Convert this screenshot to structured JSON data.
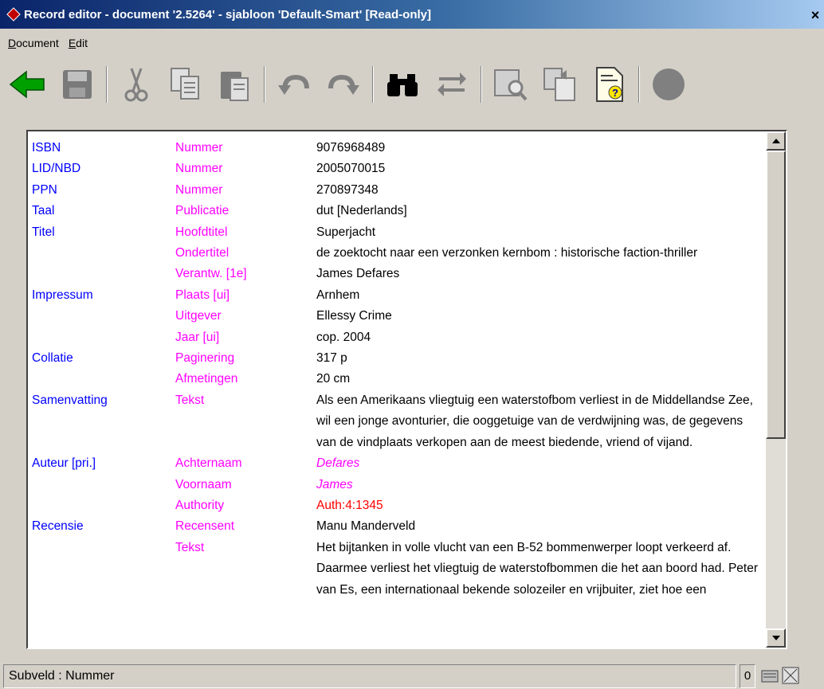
{
  "window": {
    "title": "Record editor - document '2.5264' - sjabloon 'Default-Smart' [Read-only]",
    "close_label": "×"
  },
  "menu": {
    "items": [
      "Document",
      "Edit"
    ]
  },
  "toolbar": {
    "buttons": [
      {
        "icon": "back-arrow-icon",
        "color": "#00a000"
      },
      {
        "icon": "save-icon",
        "color": "#808080"
      },
      {
        "icon": "cut-icon",
        "color": "#808080"
      },
      {
        "icon": "copy-icon",
        "color": "#808080"
      },
      {
        "icon": "paste-icon",
        "color": "#808080"
      },
      {
        "icon": "undo-icon",
        "color": "#808080"
      },
      {
        "icon": "redo-icon",
        "color": "#808080"
      },
      {
        "icon": "find-binoculars-icon",
        "color": "#000000"
      },
      {
        "icon": "replace-icon",
        "color": "#808080"
      },
      {
        "icon": "search-book-icon",
        "color": "#808080"
      },
      {
        "icon": "copy-record-icon",
        "color": "#808080"
      },
      {
        "icon": "help-document-icon",
        "color": "#0000a0"
      },
      {
        "icon": "record-circle-icon",
        "color": "#808080"
      }
    ]
  },
  "record": {
    "rows": [
      {
        "field": "ISBN",
        "sub": "Nummer",
        "value": "9076968489",
        "style": ""
      },
      {
        "field": "LID/NBD",
        "sub": "Nummer",
        "value": "2005070015",
        "style": ""
      },
      {
        "field": "PPN",
        "sub": "Nummer",
        "value": "270897348",
        "style": ""
      },
      {
        "field": "Taal",
        "sub": "Publicatie",
        "value": "dut [Nederlands]",
        "style": ""
      },
      {
        "field": "Titel",
        "sub": "Hoofdtitel",
        "value": "Superjacht",
        "style": ""
      },
      {
        "field": "",
        "sub": "Ondertitel",
        "value": "de zoektocht naar een verzonken kernbom : historische faction-thriller",
        "style": ""
      },
      {
        "field": "",
        "sub": "Verantw. [1e]",
        "value": "James Defares",
        "style": ""
      },
      {
        "field": "Impressum",
        "sub": "Plaats [ui]",
        "value": "Arnhem",
        "style": ""
      },
      {
        "field": "",
        "sub": "Uitgever",
        "value": "Ellessy Crime",
        "style": ""
      },
      {
        "field": "",
        "sub": "Jaar [ui]",
        "value": "cop. 2004",
        "style": ""
      },
      {
        "field": "Collatie",
        "sub": "Paginering",
        "value": "317 p",
        "style": ""
      },
      {
        "field": "",
        "sub": "Afmetingen",
        "value": "20 cm",
        "style": ""
      },
      {
        "field": "Samenvatting",
        "sub": "Tekst",
        "value": "Als een Amerikaans vliegtuig een waterstofbom verliest in de Middellandse Zee, wil een jonge avonturier, die ooggetuige van de verdwijning was, de gegevens van de vindplaats verkopen aan de meest biedende, vriend of vijand.",
        "style": ""
      },
      {
        "field": "Auteur [pri.]",
        "sub": "Achternaam",
        "value": "Defares",
        "style": "link"
      },
      {
        "field": "",
        "sub": "Voornaam",
        "value": "James",
        "style": "link"
      },
      {
        "field": "",
        "sub": "Authority",
        "value": "Auth:4:1345",
        "style": "auth"
      },
      {
        "field": "Recensie",
        "sub": "Recensent",
        "value": "Manu Manderveld",
        "style": ""
      },
      {
        "field": "",
        "sub": "Tekst",
        "value": "Het bijtanken in volle vlucht van een B-52 bommenwerper loopt verkeerd af. Daarmee verliest het vliegtuig de waterstofbommen die het aan boord had. Peter van Es, een internationaal bekende solozeiler en vrijbuiter, ziet hoe een",
        "style": ""
      }
    ]
  },
  "status": {
    "text": "Subveld : Nummer",
    "count": "0"
  },
  "colors": {
    "field": "#0000ff",
    "subfield": "#ff00ff",
    "authority": "#ff0000"
  }
}
